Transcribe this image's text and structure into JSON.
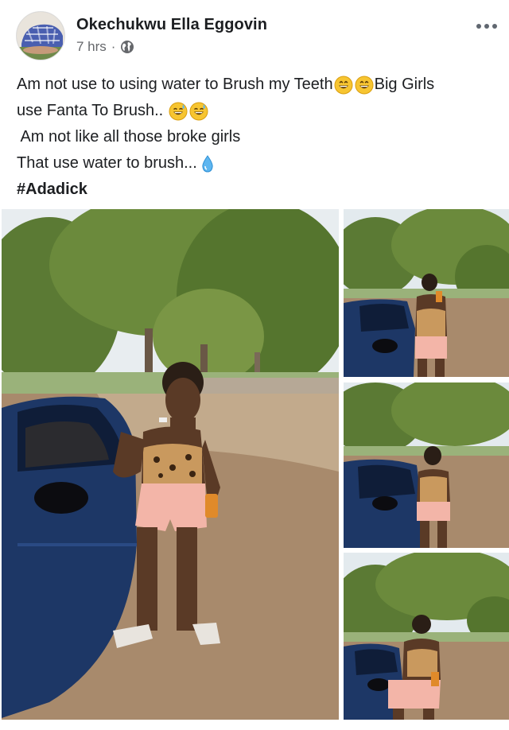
{
  "post": {
    "author": "Okechukwu Ella Eggovin",
    "time": "7 hrs",
    "separator": "·",
    "lines": [
      {
        "pre": "Am not use to using water to Brush my Teeth",
        "post": " Big Girls"
      },
      {
        "pre": "use Fanta To Brush.. ",
        "post": ""
      },
      {
        "pre": " Am not like all those broke girls",
        "post": ""
      },
      {
        "pre": "That use water to brush...",
        "post": ""
      }
    ],
    "hashtag": "#Adadick"
  },
  "icons": {
    "privacy": "globe-icon",
    "more": "more-options-icon",
    "laugh": "grinning-face-icon",
    "sweat_smile": "sweat-smile-face-icon",
    "droplet": "droplet-icon"
  },
  "photos": [
    {
      "name": "photo-main",
      "description_hidden": true
    },
    {
      "name": "photo-1"
    },
    {
      "name": "photo-2"
    },
    {
      "name": "photo-3"
    }
  ],
  "colors": {
    "text": "#1c1e21",
    "meta": "#65676b",
    "car": "#1d3766",
    "shorts": "#f3b5a8",
    "ground": "#a88a6c",
    "foliage": "#5b7a34"
  }
}
